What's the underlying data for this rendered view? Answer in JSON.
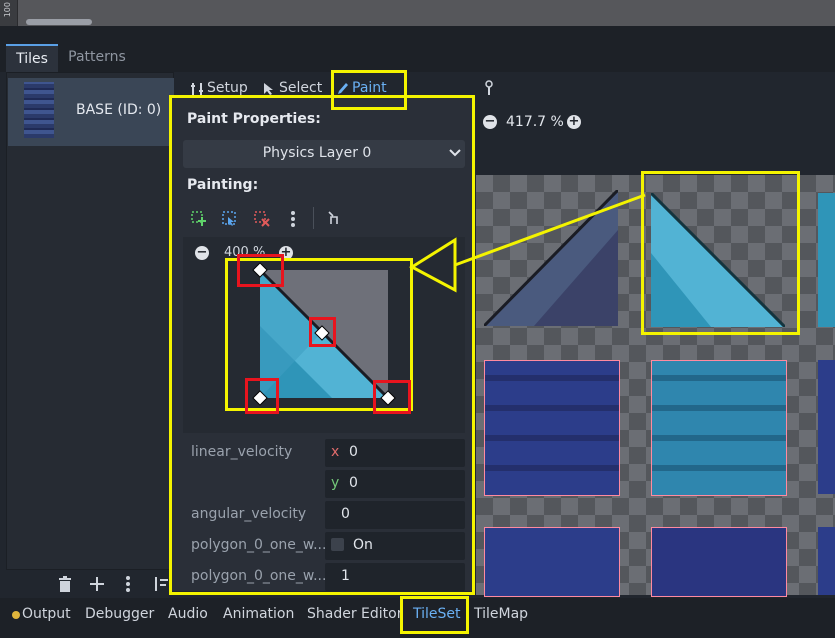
{
  "viewport": {
    "ruler_label": "100"
  },
  "tabs": [
    {
      "label": "Tiles"
    },
    {
      "label": "Patterns"
    }
  ],
  "sources": [
    {
      "label": "BASE (ID: 0)"
    }
  ],
  "toolbar": {
    "setup": "Setup",
    "select": "Select",
    "paint": "Paint"
  },
  "zoom": {
    "value": "417.7 %",
    "minus": "−",
    "plus": "+"
  },
  "paint": {
    "properties_title": "Paint Properties:",
    "selected_property": "Physics Layer 0",
    "painting_title": "Painting:",
    "editor_zoom": "400 %",
    "editor_zoom_minus": "−",
    "editor_zoom_plus": "+"
  },
  "properties": {
    "linear_velocity": {
      "label": "linear_velocity",
      "x_axis": "x",
      "y_axis": "y",
      "x": "0",
      "y": "0"
    },
    "angular_velocity": {
      "label": "angular_velocity",
      "value": "0"
    },
    "one_way": {
      "label": "polygon_0_one_w...",
      "value": "On"
    },
    "one_way_margin": {
      "label": "polygon_0_one_w...",
      "value": "1"
    }
  },
  "bottom_panel": [
    {
      "label": "Output"
    },
    {
      "label": "Debugger"
    },
    {
      "label": "Audio"
    },
    {
      "label": "Animation"
    },
    {
      "label": "Shader Editor"
    },
    {
      "label": "TileSet"
    },
    {
      "label": "TileMap"
    }
  ],
  "colors": {
    "accent": "#6ab0f3",
    "annotation_yellow": "#f4f400",
    "annotation_red": "#e8141e",
    "status_dot": "#e0b53c"
  }
}
